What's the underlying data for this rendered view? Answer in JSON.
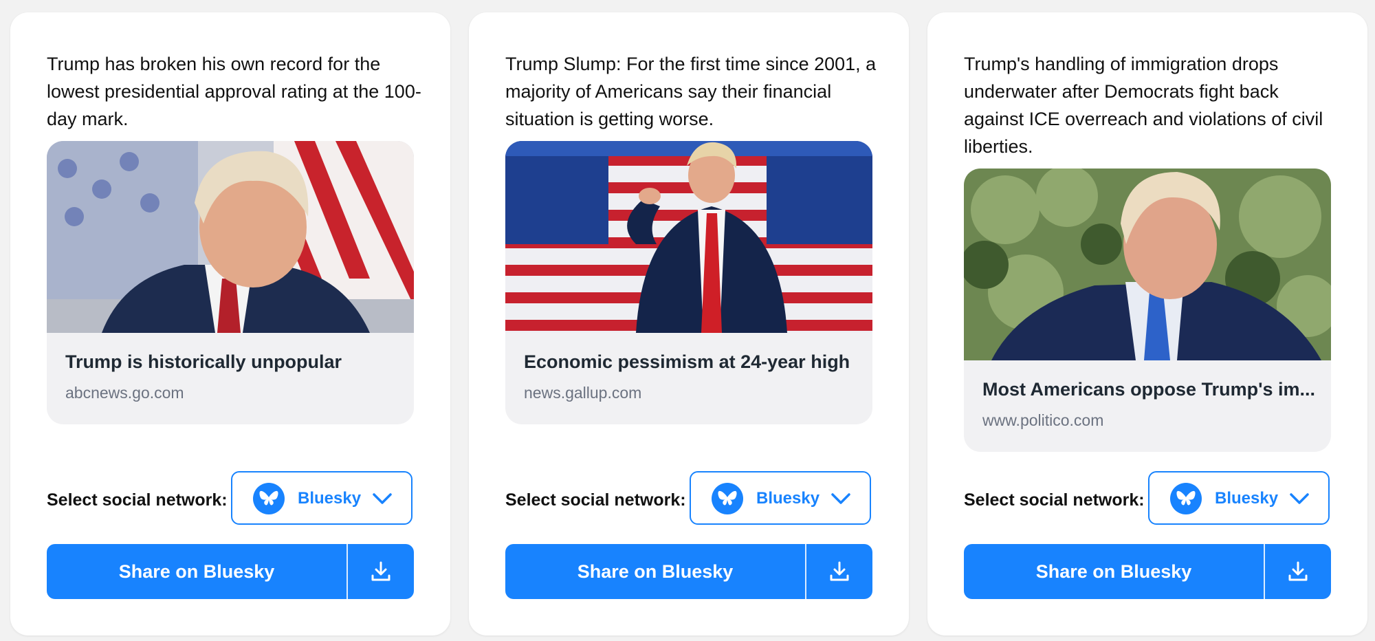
{
  "colors": {
    "accent": "#1883fe",
    "card_background": "#ffffff",
    "page_background": "#f2f2f2",
    "link_card_background": "#f1f1f3"
  },
  "cards": [
    {
      "post_text": "Trump has broken his own record for the lowest presidential approval rating at the 100-day mark.",
      "link": {
        "image": "photo of Trump seated in front of American flags",
        "title": "Trump is historically unpopular",
        "domain": "abcnews.go.com"
      },
      "network_label": "Select social network:",
      "network_selected": "Bluesky",
      "network_icon": "bluesky-butterfly-icon",
      "share_label": "Share on Bluesky",
      "download_icon": "download-icon"
    },
    {
      "post_text": "Trump Slump: For the first time since 2001, a majority of Americans say their financial situation is getting worse.",
      "link": {
        "image": "photo of Trump pointing in front of rows of American flags",
        "title": "Economic pessimism at 24-year high",
        "domain": "news.gallup.com"
      },
      "network_label": "Select social network:",
      "network_selected": "Bluesky",
      "network_icon": "bluesky-butterfly-icon",
      "share_label": "Share on Bluesky",
      "download_icon": "download-icon"
    },
    {
      "post_text": "Trump's handling of immigration drops underwater after Democrats fight back against ICE overreach and violations of civil liberties.",
      "link": {
        "image": "photo of Trump outdoors in front of green trees",
        "title": "Most Americans oppose Trump's im...",
        "domain": "www.politico.com"
      },
      "network_label": "Select social network:",
      "network_selected": "Bluesky",
      "network_icon": "bluesky-butterfly-icon",
      "share_label": "Share on Bluesky",
      "download_icon": "download-icon"
    }
  ]
}
